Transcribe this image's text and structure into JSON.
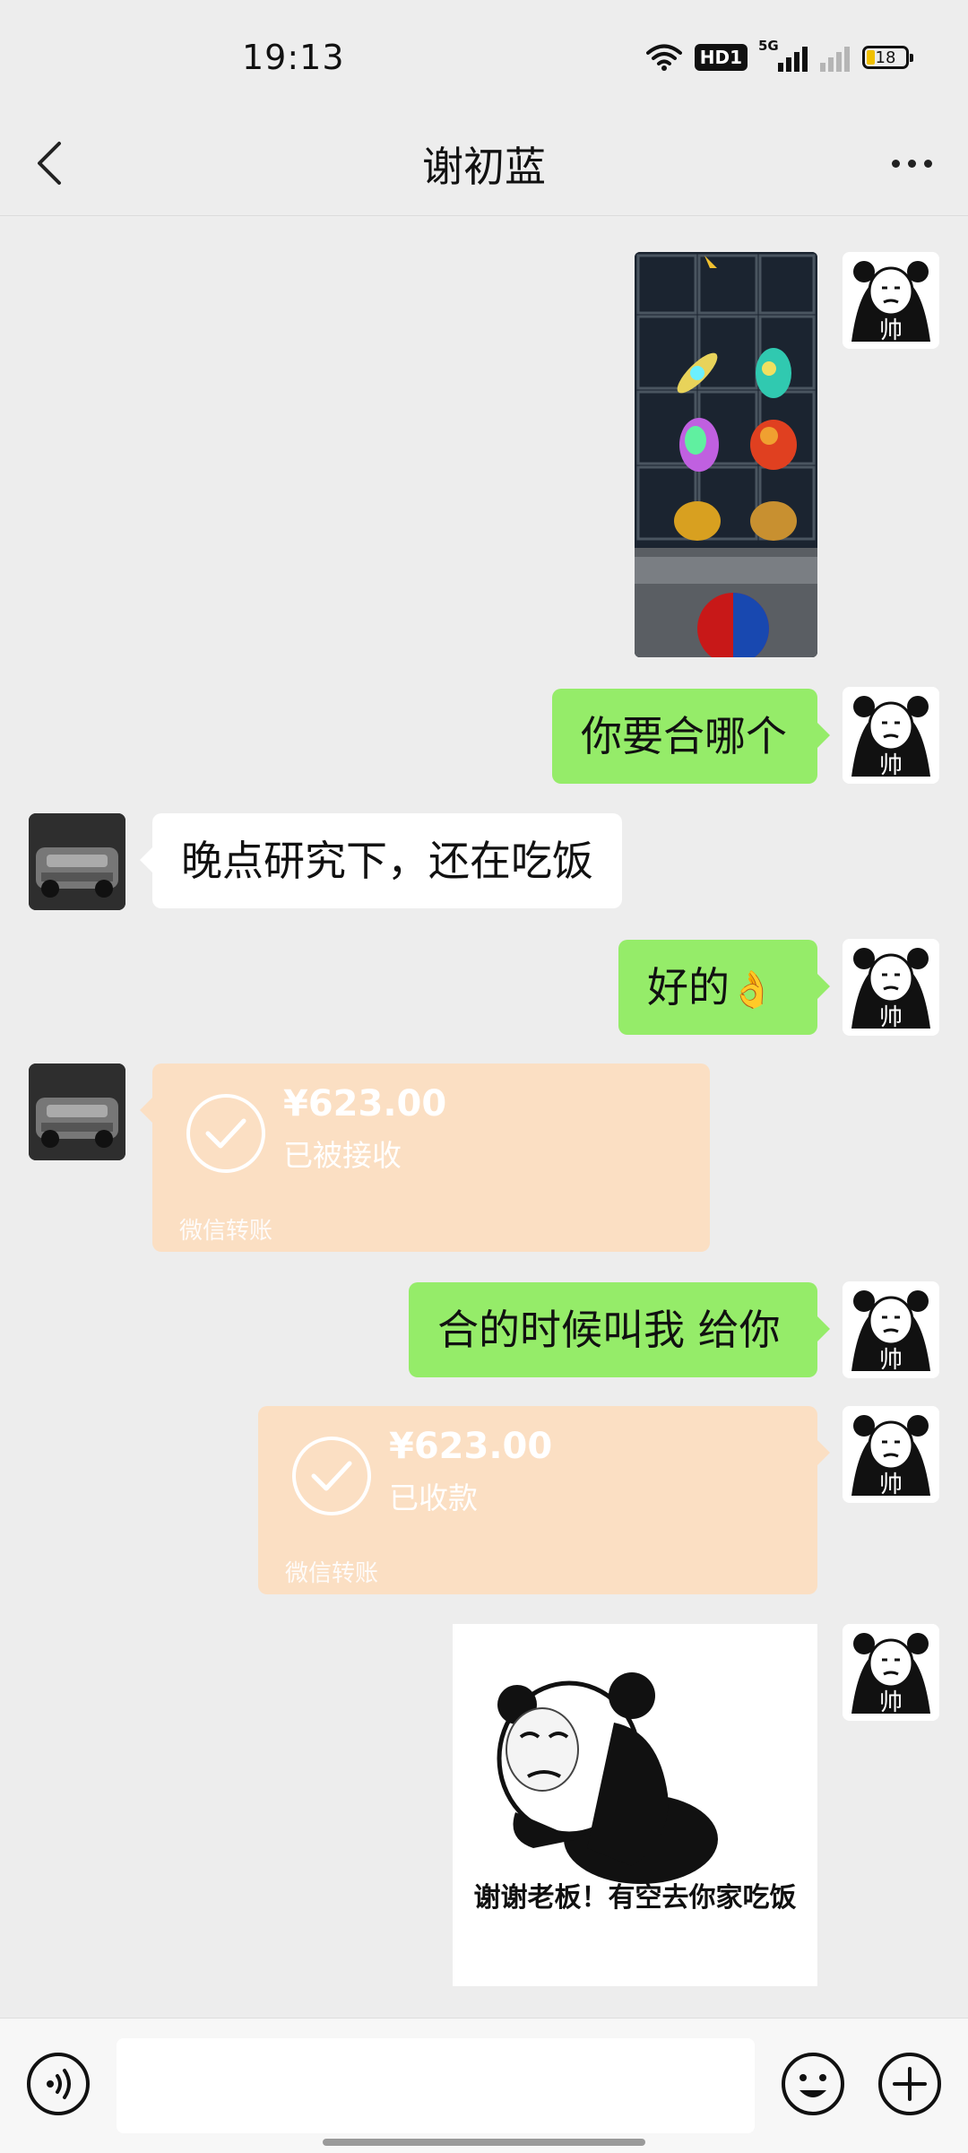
{
  "status_bar": {
    "time": "19:13",
    "network_label": "HD1",
    "signal_label": "5G",
    "battery": "18"
  },
  "nav": {
    "title": "谢初蓝"
  },
  "messages": {
    "m1": "你要合哪个",
    "m2": "晚点研究下，还在吃饭",
    "m3": "好的",
    "m3_emoji": "👌",
    "t1_amount": "¥623.00",
    "t1_status": "已被接收",
    "t1_footer": "微信转账",
    "m4": "合的时候叫我  给你",
    "t2_amount": "¥623.00",
    "t2_status": "已收款",
    "t2_footer": "微信转账",
    "sticker_text": "谢谢老板！有空去你家吃饭",
    "my_avatar_char": "帅"
  },
  "colors": {
    "my_bubble": "#95ec69",
    "transfer_bubble": "#fbdfc3",
    "background": "#ededed"
  }
}
